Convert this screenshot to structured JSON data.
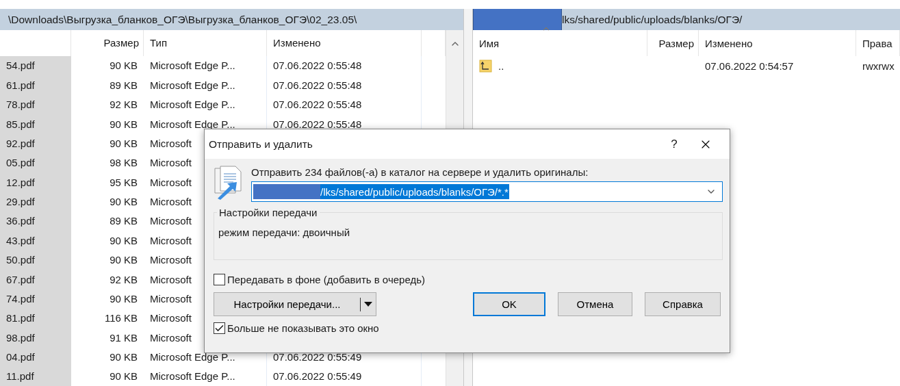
{
  "left_panel": {
    "path": "\\Downloads\\Выгрузка_бланков_ОГЭ\\Выгрузка_бланков_ОГЭ\\02_23.05\\",
    "columns": [
      {
        "label": "Размер"
      },
      {
        "label": "Тип"
      },
      {
        "label": "Изменено"
      }
    ],
    "rows": [
      {
        "name": "54.pdf",
        "size": "90 KB",
        "type": "Microsoft Edge P...",
        "modified": "07.06.2022  0:55:48",
        "selected": true
      },
      {
        "name": "61.pdf",
        "size": "89 KB",
        "type": "Microsoft Edge P...",
        "modified": "07.06.2022  0:55:48",
        "selected": true
      },
      {
        "name": "78.pdf",
        "size": "92 KB",
        "type": "Microsoft Edge P...",
        "modified": "07.06.2022  0:55:48",
        "selected": true
      },
      {
        "name": "85.pdf",
        "size": "90 KB",
        "type": "Microsoft Edge P...",
        "modified": "07.06.2022  0:55:48",
        "selected": true
      },
      {
        "name": "92.pdf",
        "size": "90 KB",
        "type": "Microsoft",
        "selected": true
      },
      {
        "name": "05.pdf",
        "size": "98 KB",
        "type": "Microsoft",
        "selected": true
      },
      {
        "name": "12.pdf",
        "size": "95 KB",
        "type": "Microsoft",
        "selected": true
      },
      {
        "name": "29.pdf",
        "size": "90 KB",
        "type": "Microsoft",
        "selected": true
      },
      {
        "name": "36.pdf",
        "size": "89 KB",
        "type": "Microsoft",
        "selected": true
      },
      {
        "name": "43.pdf",
        "size": "90 KB",
        "type": "Microsoft",
        "selected": true
      },
      {
        "name": "50.pdf",
        "size": "90 KB",
        "type": "Microsoft",
        "selected": true
      },
      {
        "name": "67.pdf",
        "size": "92 KB",
        "type": "Microsoft",
        "selected": true
      },
      {
        "name": "74.pdf",
        "size": "90 KB",
        "type": "Microsoft",
        "selected": true
      },
      {
        "name": "81.pdf",
        "size": "116 KB",
        "type": "Microsoft",
        "selected": true
      },
      {
        "name": "98.pdf",
        "size": "91 KB",
        "type": "Microsoft",
        "selected": true
      },
      {
        "name": "04.pdf",
        "size": "90 KB",
        "type": "Microsoft Edge P...",
        "modified": "07.06.2022  0:55:49",
        "selected": true
      },
      {
        "name": "11.pdf",
        "size": "90 KB",
        "type": "Microsoft Edge P...",
        "modified": "07.06.2022  0:55:49",
        "selected": true
      }
    ]
  },
  "right_panel": {
    "path": "lks/shared/public/uploads/blanks/ОГЭ/",
    "columns": [
      {
        "label": "Имя",
        "sorted": true
      },
      {
        "label": "Размер",
        "sorted": false
      },
      {
        "label": "Изменено",
        "sorted": false
      },
      {
        "label": "Права",
        "sorted": false
      }
    ],
    "rows": [
      {
        "kind": "parent-folder",
        "name": "..",
        "modified": "07.06.2022 0:54:57",
        "permissions": "rwxrwx"
      }
    ]
  },
  "dialog": {
    "title": "Отправить и удалить",
    "help": "?",
    "message": "Отправить 234 файлов(-а) в каталог на сервере и удалить оригиналы:",
    "destination": {
      "value": "/lks/shared/public/uploads/blanks/ОГЭ/*.*",
      "text_selected": true
    },
    "group": {
      "legend": "Настройки передачи",
      "text": "режим передачи: двоичный"
    },
    "checkboxes": [
      {
        "label": "Передавать в фоне (добавить в очередь)",
        "checked": false
      }
    ],
    "buttons": [
      {
        "label": "Настройки передачи...",
        "kind": "split"
      },
      {
        "label": "OK",
        "kind": "default"
      },
      {
        "label": "Отмена",
        "kind": "normal"
      },
      {
        "label": "Справка",
        "kind": "normal"
      }
    ],
    "footer_checkbox": {
      "label": "Больше не показывать это окно",
      "checked": true
    }
  }
}
